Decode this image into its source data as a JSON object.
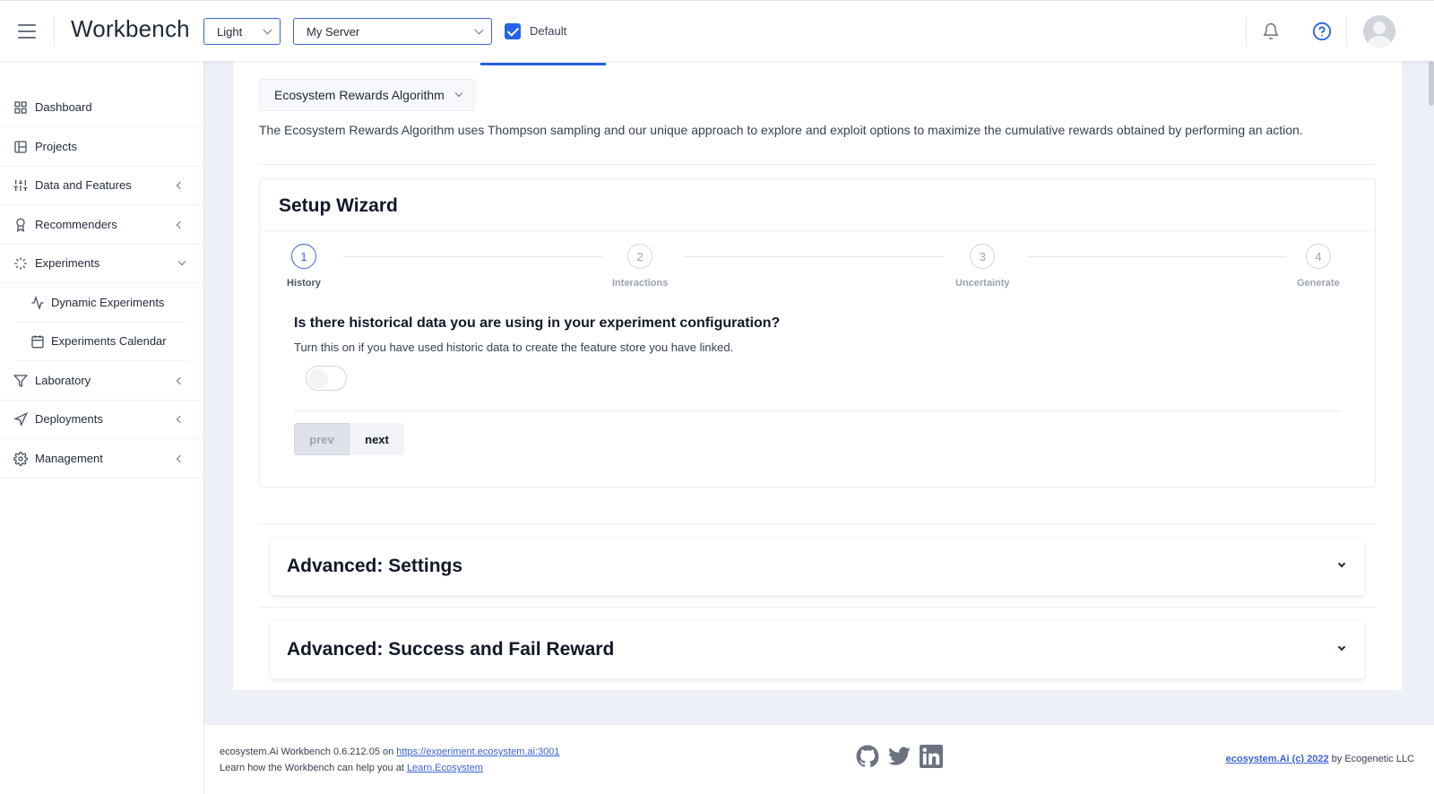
{
  "header": {
    "app_title": "Workbench",
    "theme_select": "Light",
    "server_select": "My Server",
    "default_label": "Default"
  },
  "sidebar": {
    "items": [
      {
        "label": "Dashboard",
        "icon": "grid-icon"
      },
      {
        "label": "Projects",
        "icon": "project-board-icon"
      },
      {
        "label": "Data and Features",
        "icon": "sliders-icon"
      },
      {
        "label": "Recommenders",
        "icon": "award-icon"
      },
      {
        "label": "Experiments",
        "icon": "loader-icon"
      },
      {
        "label": "Dynamic Experiments",
        "icon": "activity-icon"
      },
      {
        "label": "Experiments Calendar",
        "icon": "calendar-icon"
      },
      {
        "label": "Laboratory",
        "icon": "filter-icon"
      },
      {
        "label": "Deployments",
        "icon": "send-icon"
      },
      {
        "label": "Management",
        "icon": "settings-icon"
      }
    ]
  },
  "main": {
    "algorithm_select": "Ecosystem Rewards Algorithm",
    "algorithm_description": "The Ecosystem Rewards Algorithm uses Thompson sampling and our unique approach to explore and exploit options to maximize the cumulative rewards obtained by performing an action.",
    "wizard": {
      "title": "Setup Wizard",
      "steps": [
        {
          "number": "1",
          "label": "History"
        },
        {
          "number": "2",
          "label": "Interactions"
        },
        {
          "number": "3",
          "label": "Uncertainty"
        },
        {
          "number": "4",
          "label": "Generate"
        }
      ],
      "question": "Is there historical data you are using in your experiment configuration?",
      "question_help": "Turn this on if you have used historic data to create the feature store you have linked.",
      "prev_label": "prev",
      "next_label": "next"
    },
    "accordions": [
      {
        "title": "Advanced: Settings"
      },
      {
        "title": "Advanced: Success and Fail Reward"
      }
    ]
  },
  "footer": {
    "version_text": "ecosystem.Ai Workbench 0.6.212.05 on ",
    "version_link": "https://experiment.ecosystem.ai:3001",
    "learn_text": "Learn how the Workbench can help you at ",
    "learn_link": "Learn.Ecosystem",
    "copyright_link": "ecosystem.Ai (c) 2022",
    "copyright_text": " by Ecogenetic LLC"
  },
  "colors": {
    "accent": "#2563eb",
    "background": "#eef0f7"
  }
}
